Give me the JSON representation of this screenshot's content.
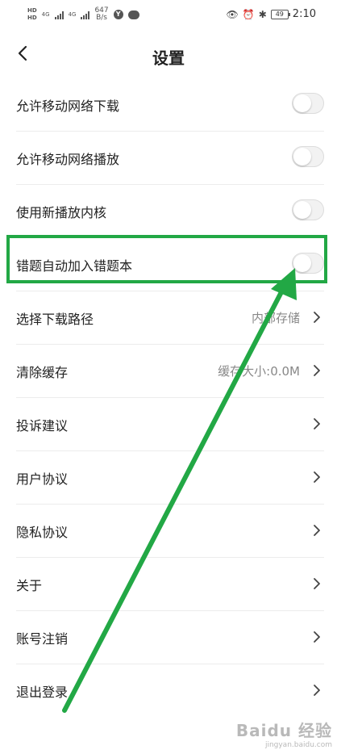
{
  "status_bar": {
    "hd1": "HD",
    "hd2": "HD",
    "net1": "4G",
    "net2": "4G",
    "speed_value": "647",
    "speed_unit": "B/s",
    "badge": "Y",
    "battery": "49",
    "time": "2:10"
  },
  "header": {
    "title": "设置"
  },
  "settings": [
    {
      "label": "允许移动网络下载",
      "type": "toggle",
      "on": false
    },
    {
      "label": "允许移动网络播放",
      "type": "toggle",
      "on": false
    },
    {
      "label": "使用新播放内核",
      "type": "toggle",
      "on": false
    },
    {
      "label": "错题自动加入错题本",
      "type": "toggle",
      "on": false,
      "highlighted": true
    },
    {
      "label": "选择下载路径",
      "type": "nav",
      "value": "内部存储"
    },
    {
      "label": "清除缓存",
      "type": "nav",
      "value": "缓存大小:0.0M"
    },
    {
      "label": "投诉建议",
      "type": "nav"
    },
    {
      "label": "用户协议",
      "type": "nav"
    },
    {
      "label": "隐私协议",
      "type": "nav"
    },
    {
      "label": "关于",
      "type": "nav"
    },
    {
      "label": "账号注销",
      "type": "nav"
    },
    {
      "label": "退出登录",
      "type": "nav"
    }
  ],
  "annotation": {
    "color": "#22a845"
  },
  "watermark": {
    "main": "Baidu 经验",
    "sub": "jingyan.baidu.com"
  }
}
